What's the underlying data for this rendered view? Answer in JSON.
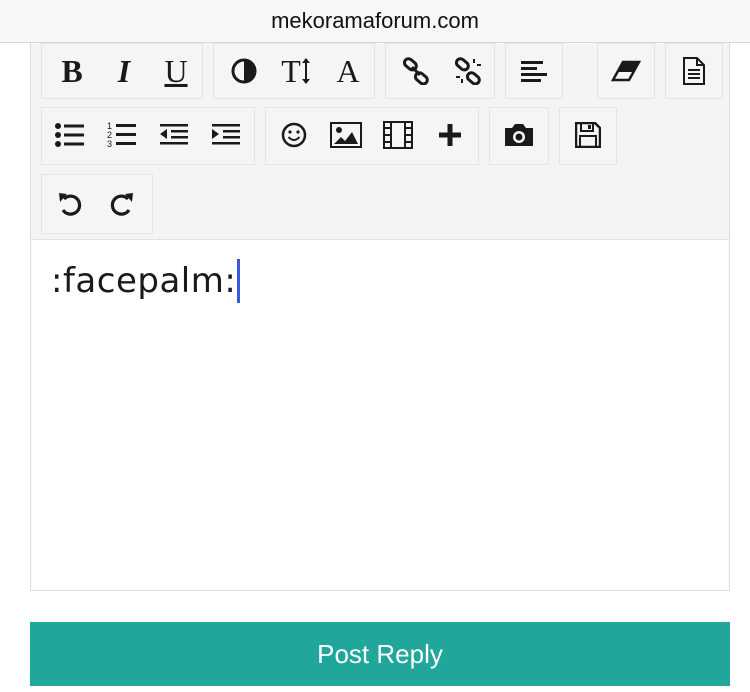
{
  "browser": {
    "url": "mekoramaforum.com"
  },
  "toolbar": {
    "bold": "B",
    "italic": "I",
    "underline": "U",
    "font": "A",
    "size": "T"
  },
  "editor": {
    "content": ":facepalm:"
  },
  "actions": {
    "post_label": "Post Reply"
  },
  "colors": {
    "accent": "#20a69a",
    "caret": "#3b5bdb"
  }
}
